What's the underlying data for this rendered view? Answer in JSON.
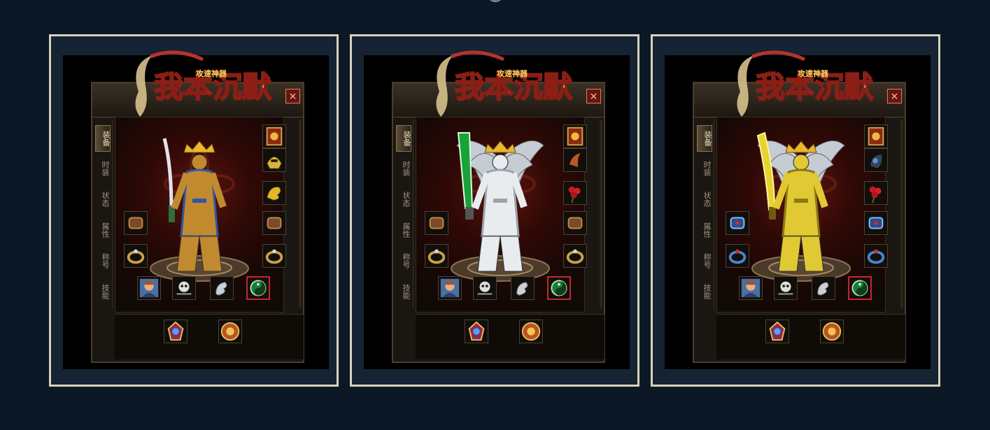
{
  "colors": {
    "background": "#0d1826",
    "card_border": "#d7d2bd",
    "close_red": "#6b1410",
    "selected_slot": "#c6262b"
  },
  "cards": [
    {
      "logo_text": "我本沉默",
      "subtitle": "攻速神器",
      "close_label": "×",
      "tabs": [
        "装备",
        "时装",
        "状态",
        "属性",
        "称号",
        "技能"
      ],
      "active_tab": "装备",
      "character": {
        "robe": "#c28a2e",
        "trim": "#2f57a5",
        "weapon": "silver-saber",
        "wings": "none"
      },
      "slots": [
        "rank-medal-icon",
        "helmet-icon",
        "dragon-icon",
        "bracelet-icon",
        "bracelet-icon",
        "ring-icon",
        "ring-icon",
        "portrait-icon",
        "skull-charm-icon",
        "dragon-charm-icon",
        "yin-yang-icon",
        "gem-icon",
        "medallion-icon"
      ]
    },
    {
      "logo_text": "我本沉默",
      "subtitle": "攻速神器",
      "close_label": "×",
      "tabs": [
        "装备",
        "时装",
        "状态",
        "属性",
        "称号",
        "技能"
      ],
      "active_tab": "装备",
      "character": {
        "robe": "#e9ecef",
        "trim": "#9aa3ad",
        "weapon": "green-blade",
        "wings": "silver"
      },
      "slots": [
        "rank-medal-icon",
        "horn-helm-icon",
        "rose-icon",
        "bracelet-icon",
        "bracelet-icon",
        "ring-icon",
        "ring-icon",
        "portrait-icon",
        "skull-charm-icon",
        "dragon-charm-icon",
        "yin-yang-icon",
        "gem-icon",
        "medallion-icon"
      ]
    },
    {
      "logo_text": "我本沉默",
      "subtitle": "攻速神器",
      "close_label": "×",
      "tabs": [
        "装备",
        "时装",
        "状态",
        "属性",
        "称号",
        "技能"
      ],
      "active_tab": "装备",
      "character": {
        "robe": "#e0c933",
        "trim": "#8a7a10",
        "weapon": "gold-blade",
        "wings": "silver"
      },
      "slots": [
        "rank-medal-icon",
        "dark-helm-icon",
        "rose-icon",
        "blue-bracelet-icon",
        "blue-bracelet-icon",
        "blue-ring-icon",
        "blue-ring-icon",
        "portrait-icon",
        "skull-charm-icon",
        "dragon-charm-icon",
        "yin-yang-icon",
        "gem-icon",
        "medallion-icon"
      ]
    }
  ]
}
